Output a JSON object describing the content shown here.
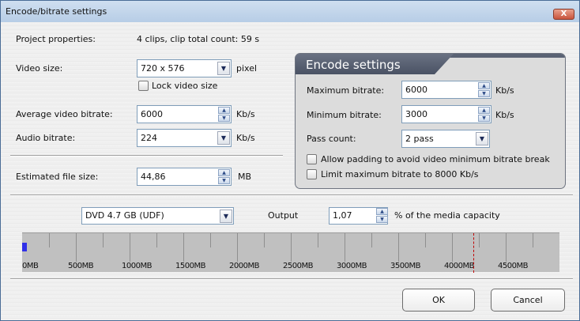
{
  "window": {
    "title": "Encode/bitrate settings",
    "close_label": "X"
  },
  "project": {
    "label": "Project properties:",
    "value": "4 clips,  clip total count: 59 s"
  },
  "video_size": {
    "label": "Video size:",
    "value": "720 x 576",
    "unit": "pixel"
  },
  "lock_video_size": {
    "label": "Lock video size",
    "checked": false
  },
  "avg_bitrate": {
    "label": "Average video bitrate:",
    "value": "6000",
    "unit": "Kb/s"
  },
  "audio_bitrate": {
    "label": "Audio bitrate:",
    "value": "224",
    "unit": "Kb/s"
  },
  "file_size": {
    "label": "Estimated file size:",
    "value": "44,86",
    "unit": "MB"
  },
  "encode": {
    "title": "Encode settings",
    "max_bitrate": {
      "label": "Maximum bitrate:",
      "value": "6000",
      "unit": "Kb/s"
    },
    "min_bitrate": {
      "label": "Minimum bitrate:",
      "value": "3000",
      "unit": "Kb/s"
    },
    "pass_count": {
      "label": "Pass count:",
      "value": "2 pass"
    },
    "allow_padding": {
      "label": "Allow padding to avoid video minimum bitrate break",
      "checked": false
    },
    "limit_max": {
      "label": "Limit maximum bitrate to 8000 Kb/s",
      "checked": false
    }
  },
  "media": {
    "value": "DVD 4.7 GB (UDF)",
    "output_label": "Output",
    "output_value": "1,07",
    "capacity_label": "% of the media capacity"
  },
  "gauge": {
    "max_mb": 5000,
    "used_mb": 44.86,
    "limit_mb": 4200,
    "tick_step_mb": 250,
    "labels": [
      "0MB",
      "500MB",
      "1000MB",
      "1500MB",
      "2000MB",
      "2500MB",
      "3000MB",
      "3500MB",
      "4000MB",
      "4500MB"
    ],
    "fill_color": "#3030e8",
    "limit_color": "#c00000"
  },
  "buttons": {
    "ok": "OK",
    "cancel": "Cancel"
  }
}
